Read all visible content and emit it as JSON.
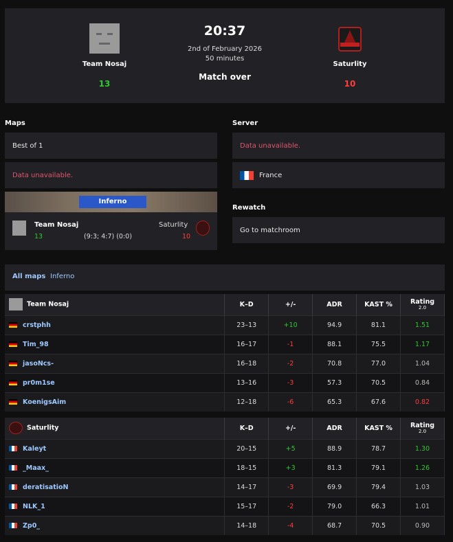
{
  "match": {
    "time": "20:37",
    "date": "2nd of February 2026",
    "duration": "50 minutes",
    "status": "Match over",
    "team1": {
      "name": "Team Nosaj",
      "score": "13"
    },
    "team2": {
      "name": "Saturlity",
      "score": "10"
    }
  },
  "maps": {
    "label": "Maps",
    "best_of": "Best of 1",
    "unavailable": "Data unavailable.",
    "map_name": "Inferno",
    "team1": "Team Nosaj",
    "team2": "Saturlity",
    "score1": "13",
    "score2": "10",
    "half_scores": "(9:3; 4:7) (0:0)"
  },
  "server": {
    "label": "Server",
    "unavailable": "Data unavailable.",
    "country": "France"
  },
  "rewatch": {
    "label": "Rewatch",
    "link": "Go to matchroom"
  },
  "stats_tabs": {
    "all": "All maps",
    "map": "Inferno"
  },
  "columns": {
    "kd": "K–D",
    "pm": "+/-",
    "adr": "ADR",
    "kast": "KAST %",
    "rating": "Rating",
    "rating_ver": "2.0"
  },
  "team1_stats": {
    "name": "Team Nosaj",
    "players": [
      {
        "name": "crstphh",
        "flag": "de",
        "kd": "23–13",
        "pm": "+10",
        "adr": "94.9",
        "kast": "81.1",
        "rating": "1.51"
      },
      {
        "name": "Tim_98",
        "flag": "de",
        "kd": "16–17",
        "pm": "-1",
        "adr": "88.1",
        "kast": "75.5",
        "rating": "1.17"
      },
      {
        "name": "jasoNcs-",
        "flag": "de",
        "kd": "16–18",
        "pm": "-2",
        "adr": "70.8",
        "kast": "77.0",
        "rating": "1.04"
      },
      {
        "name": "pr0m1se",
        "flag": "de",
        "kd": "13–16",
        "pm": "-3",
        "adr": "57.3",
        "kast": "70.5",
        "rating": "0.84"
      },
      {
        "name": "KoenigsAim",
        "flag": "de",
        "kd": "12–18",
        "pm": "-6",
        "adr": "65.3",
        "kast": "67.6",
        "rating": "0.82"
      }
    ]
  },
  "team2_stats": {
    "name": "Saturlity",
    "players": [
      {
        "name": "Kaleyt",
        "flag": "fr",
        "kd": "20–15",
        "pm": "+5",
        "adr": "88.9",
        "kast": "78.7",
        "rating": "1.30"
      },
      {
        "name": "_Maax_",
        "flag": "fr",
        "kd": "18–15",
        "pm": "+3",
        "adr": "81.3",
        "kast": "79.1",
        "rating": "1.26"
      },
      {
        "name": "deratisatioN",
        "flag": "fr",
        "kd": "14–17",
        "pm": "-3",
        "adr": "69.9",
        "kast": "79.4",
        "rating": "1.03"
      },
      {
        "name": "NLK_1",
        "flag": "fr",
        "kd": "15–17",
        "pm": "-2",
        "adr": "79.0",
        "kast": "66.3",
        "rating": "1.01"
      },
      {
        "name": "Zp0_",
        "flag": "fr",
        "kd": "14–18",
        "pm": "-4",
        "adr": "68.7",
        "kast": "70.5",
        "rating": "0.90"
      }
    ]
  },
  "colors": {
    "positive": "#2ec92e",
    "negative": "#ff3c3c",
    "link": "#9ec9ff",
    "warn": "#e0566e"
  }
}
